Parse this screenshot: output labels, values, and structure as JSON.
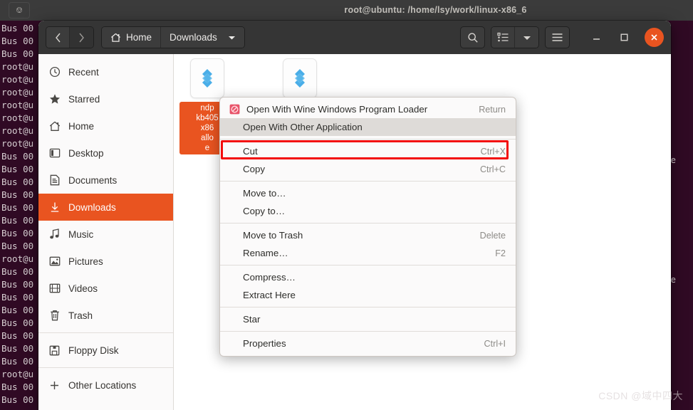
{
  "terminal": {
    "title": "root@ubuntu: /home/lsy/work/linux-x86_6",
    "new_tab_icon": "new-tab-icon",
    "lines": [
      "Bus 00",
      "Bus 00",
      "Bus 00",
      "root@u",
      "root@u",
      "root@u",
      "root@u",
      "root@u",
      "root@u",
      "root@u",
      "Bus 00",
      "Bus 00",
      "Bus 00",
      "Bus 00",
      "Bus 00",
      "Bus 00",
      "Bus 00",
      "Bus 00",
      "root@u",
      "Bus 00",
      "Bus 00",
      "Bus 00",
      "Bus 00",
      "Bus 00",
      "Bus 00",
      "Bus 00",
      "Bus 00",
      "root@u",
      "Bus 00",
      "Bus 00"
    ],
    "right_fragments": [
      "e",
      "e"
    ]
  },
  "headerbar": {
    "back_icon": "chevron-left-icon",
    "forward_icon": "chevron-right-icon",
    "home_icon": "home-icon",
    "home_label": "Home",
    "current_label": "Downloads",
    "dropdown_icon": "chevron-down-icon",
    "search_icon": "search-icon",
    "view_list_icon": "list-view-icon",
    "view_dropdown_icon": "chevron-down-icon",
    "menu_icon": "hamburger-menu-icon",
    "minimize_icon": "minimize-icon",
    "maximize_icon": "maximize-icon",
    "close_icon": "close-icon"
  },
  "sidebar": {
    "items": [
      {
        "label": "Recent",
        "icon": "clock-icon",
        "active": false
      },
      {
        "label": "Starred",
        "icon": "star-icon",
        "active": false
      },
      {
        "label": "Home",
        "icon": "home-icon",
        "active": false
      },
      {
        "label": "Desktop",
        "icon": "desktop-icon",
        "active": false
      },
      {
        "label": "Documents",
        "icon": "documents-icon",
        "active": false
      },
      {
        "label": "Downloads",
        "icon": "download-icon",
        "active": true
      },
      {
        "label": "Music",
        "icon": "music-note-icon",
        "active": false
      },
      {
        "label": "Pictures",
        "icon": "picture-icon",
        "active": false
      },
      {
        "label": "Videos",
        "icon": "video-film-icon",
        "active": false
      },
      {
        "label": "Trash",
        "icon": "trash-icon",
        "active": false
      },
      {
        "label": "Floppy Disk",
        "icon": "floppy-disk-icon",
        "active": false
      },
      {
        "label": "Other Locations",
        "icon": "plus-icon",
        "active": false
      }
    ]
  },
  "files": [
    {
      "icon": "wine-executable-icon",
      "label": "ndp\nkb405\nx86\nallo\ne",
      "selected": true
    },
    {
      "icon": "wine-executable-icon",
      "label": "",
      "selected": false
    }
  ],
  "context_menu": {
    "items": [
      {
        "label": "Open With Wine Windows Program Loader",
        "accel": "Return",
        "icon": "wine-loader-icon",
        "highlight": false,
        "separator_after": false
      },
      {
        "label": "Open With Other Application",
        "accel": "",
        "icon": "",
        "highlight": true,
        "separator_after": true
      },
      {
        "label": "Cut",
        "accel": "Ctrl+X",
        "icon": "",
        "highlight": false,
        "separator_after": false
      },
      {
        "label": "Copy",
        "accel": "Ctrl+C",
        "icon": "",
        "highlight": false,
        "separator_after": true
      },
      {
        "label": "Move to…",
        "accel": "",
        "icon": "",
        "highlight": false,
        "separator_after": false
      },
      {
        "label": "Copy to…",
        "accel": "",
        "icon": "",
        "highlight": false,
        "separator_after": true
      },
      {
        "label": "Move to Trash",
        "accel": "Delete",
        "icon": "",
        "highlight": false,
        "separator_after": false
      },
      {
        "label": "Rename…",
        "accel": "F2",
        "icon": "",
        "highlight": false,
        "separator_after": true
      },
      {
        "label": "Compress…",
        "accel": "",
        "icon": "",
        "highlight": false,
        "separator_after": false
      },
      {
        "label": "Extract Here",
        "accel": "",
        "icon": "",
        "highlight": false,
        "separator_after": true
      },
      {
        "label": "Star",
        "accel": "",
        "icon": "",
        "highlight": false,
        "separator_after": true
      },
      {
        "label": "Properties",
        "accel": "Ctrl+I",
        "icon": "",
        "highlight": false,
        "separator_after": false
      }
    ]
  },
  "watermark": {
    "text": "CSDN @域中四大"
  },
  "colors": {
    "ubuntu_orange": "#e95420",
    "terminal_bg": "#300a24",
    "headerbar_bg": "#353535",
    "annotation_red": "#f30c0c",
    "menu_bg": "#fbfafa",
    "menu_highlight": "#dedbd8"
  }
}
